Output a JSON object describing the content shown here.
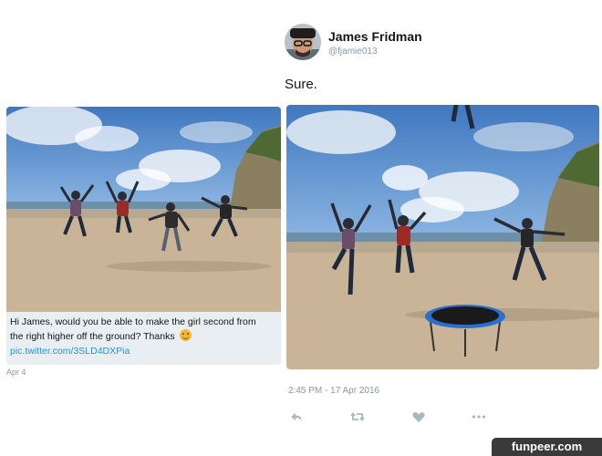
{
  "author": {
    "name": "James Fridman",
    "handle": "@fjamie013",
    "avatar_icon": "profile-avatar"
  },
  "reply": {
    "text": "Sure.",
    "timestamp": "2:45 PM - 17 Apr 2016"
  },
  "original_tweet": {
    "line1": "Hi James, would you be able to make the girl second from",
    "line2": "the right higher off the ground? Thanks",
    "emoji_icon": "smiling-face-emoji",
    "link": "pic.twitter.com/3SLD4DXPia",
    "date": "Apr 4"
  },
  "actions": {
    "reply_icon": "reply-icon",
    "retweet_icon": "retweet-icon",
    "like_icon": "heart-icon",
    "more_icon": "more-icon"
  },
  "watermark": "funpeer.com",
  "colors": {
    "link": "#1b95e0",
    "muted": "#8899a6",
    "sky": "#4f86c6",
    "sand": "#c9b497"
  }
}
